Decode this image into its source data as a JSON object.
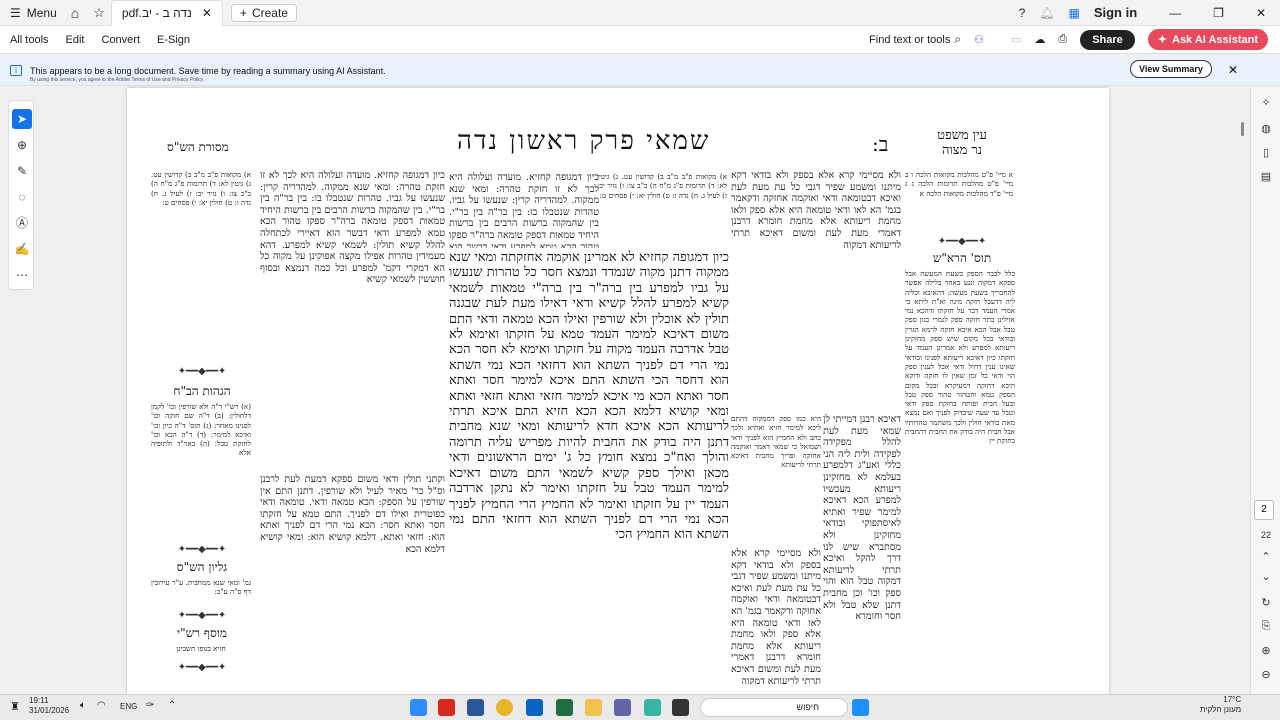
{
  "titlebar": {
    "menu_label": "Menu",
    "tab_title": "נדה ב - יב.pdf",
    "create_label": "Create",
    "signin_label": "Sign in"
  },
  "toolbar": {
    "menus": [
      "All tools",
      "Edit",
      "Convert",
      "E-Sign"
    ],
    "find_label": "Find text or tools",
    "share_label": "Share",
    "askai_label": "Ask AI Assistant"
  },
  "banner": {
    "message": "This appears to be a long document. Save time by reading a summary using AI Assistant.",
    "subtext": "By using this service, you agree to the Adobe Terms of Use and Privacy Policy.",
    "view_summary_label": "View Summary"
  },
  "page": {
    "bet": "ב:",
    "title": "שמאי פרק ראשון נדה",
    "ein_mishpat": "עין משפט\nנר מצוה",
    "masoret": "מסורת הש\"ס",
    "tosfot_label": "תוס' הרא\"ש",
    "hagahot_label": "הגהות הב\"ח",
    "gilyon_label": "גליון הש\"ס",
    "musaf_label": "מוסף רש\"י",
    "main_text": "כיון דמגופה קחזיא לא אמרינן אוקמה אחזקתה ומאי שנא ממקוה דתנן מקוה שנמדד ונמצא חסר כל טהרות שנעשו על גביו למפרע בין ברה\"ר בין ברה\"י טמאות לשמאי קשיא למפרע להלל קשיא ודאי דאילו מעת לעת שבגנה תולין לא אוכלין ולא שורפין ואילו הכא טמאה ודאי התם משום דאיכא למימר העמד טמא על חזקתו ואימא לא טבל אדרבה העמד מקוה על חזקתו ואימא לא חסר הכא נמי הרי דם לפניך השתא הוא דחזאי הכא נמי השתא הוא דחסר הכי השתא התם איכא למימר חסר ואתא חסר ואתא הכא מי איכא למימר חזאי ואתא חזאי ואתא ומאי קושיא דלמא הכא הכא חזיא התם איכא תרתי לריעותא הכא איכא חדא לריעותא ומאי שנא מחבית דתנן היה בודק את החבית להיות מפריש עליה תרומה והולך ואח\"כ נמצא חומץ כל ג' ימים הראשונים ודאי מכאן ואילך ספק קשיא לשמאי התם משום דאיכא למימר העמד טבל על חזקתו ואימר לא נתקן ארדבה העמד יין על חזקתו ואימר לא החמיץ הרי החמיץ לפניך הכא נמי הרי דם לפניך השתא הוא דחזאי התם נמי השתא הוא החמיץ הכי",
    "left_col_a": "כיון דמגופה קחזיא. מועדה ועלולה היא לכך לא זו חזקת טהרה: ומאי שנא ממקוה. למהדריה קרין: שנעשו על גביו. טהרות שנטבלו בו: בין בר\"ה בין בר\"י. בין שהמקוה ברשות הרבים בין ברשות היחיד טמאות דספק טומאה ברה\"ר ספקו טהור הכא טמא למפרע ודאי דבשר הוא דאיירי לכתחלה להלל קשיא תולין: לשמאי קשיא למפרע. דהא מעמידין טהרות אפילו מקצה אפוקינן על מקוה כל הא דמקרי דקמ' למפרע וכל כמה דנמצא ובסוף חוששין לשמאי קשיא",
    "left_col_b": "וקתני תולין ודאי משום ספקא דמעת לעת לרבנן וס\"ל כר' מאיר לעיל ולא שורפין. דתנן התם אין שורפין על הספק: הכא טמאה ודאי. טומאה ודאי כפוטרית ואילו דם לפניך. התם טמא על חזקתו חסר ואתא חסר: הכא נמי הרי דם לפניך ואתא הוא: חזאי ואתא. דלמא קושיא הוא: ומאי קושיא דלמא הכא",
    "right_col_a": "ולא מסיימי קרא אלא בספק ולא בודאי דקא מיתנו ומשמע שפיר דגבי כל עת מעת לעת ואיכא דבטומאה ודאי ואוקמה אחזקה ודקאמר בגמ' הא לאו ודאי טומאה היא אלא ספק ולאו מחמת ריעותא אלא מחמת חומרא דרבנן דאמרי מעת לעת ומשום דאיכא תרתי לריעותא דמקוה",
    "right_col_b": "דאיבא רבנן דמייתי לן שמאי מעת לעת להלל מפקידה לפקידה ולית ליה הני כללי ואע\"ג דלמפרע בעלמא לא מחזקינן ריעותא מעכשיו למפרע הכא דאיכא למימר שפיר ואתיא לאיסתפוקי ובודאי מחזקינן ולא מסתברא שיש לנו דרך להקל ואיכא תרתי לריעותא דמקוה טבל הוא והוי ספק וכו' וכן מחבית דתנן שלא טבל ולא חסר וחומרא",
    "right_col_c": "היא כמו ספק דממקוה דהתם ליכא למימר חזיא ואתיא ולכך כתב ולא החמיץ הוא לפניך ודאי ושמואל כי שמאי דאמר ואוקמה אחזקה ופריך מחבית דאיכא תרתי לריעותא",
    "far_right": "כלל לבבר הספק בשעת המעשה אבל ספקא דמקוה ונגע באהר בלילה אפשר להחבריך בשעת מעשה: דהאיבא וכליה ליה דדעבל חזקה מינה וא\"ת ליתא כי אמרי העמד דבר על חזקתו ודהכא נמי אזילינן בתר חזקה ספק לגמרי כגון ספק טבל אבל הכא איכא חזקה לרמא הגרין ובודאי בכל מקום שיש ספק מחזקינן ריעותא למפרע ולא אמרינן העמד על חזקתו כיון דאיכא ריעותא לפנינו ובודאי שאינו ענין דחיל ודאי אבל לענין ספק הוי ודאי כל זמן שאין לו חזקה ודוקא היכא דחזקה דמעיקרא ובכל מקום הספק טמא והטהור טהור",
    "far_right_b": "ספק טבל ובעל הבית ופותח בחזקת ספק ודאי וטבל עד שעה שיבדוק לפניך ואם נמצא מאת בודאי חולין ולכך משתמר טהרותיו אבל חבית היה בודק את החבית דהחבית בחזקת יין",
    "small_notes": "א) מקואות פ\"ב מ\"ב ב) קדושין עט. ג) גיטין לא: ד) תרומות פ\"ג מ\"ח ה) ב\"ב צו: ו) נזיר יב: ז) לעיל ג. ח) נדה ו: ט) חולין יא: י) פסחים ט:",
    "hagahot_text": "(א) רש\"י ד\"ה ולא שורפין וכו' לקמן דלחולין: (ב) ד\"ה שם חזקה וכו' לפנינו מאחר: (ג) תוס' ד\"ה כיון וכו' ואיכא למימר: (ד) ד\"ה הכא וכו' לחזקת טבל: (ה) באר\"ד ולתופיה אלא",
    "gilyon_text": "גמ' ומאי שנא ממחבית. ע\"ר עירובין דף ס\"ה ע\"ב:",
    "musaf_text": "חזיא בגופו חשבינן",
    "ein_notes": "א מיי' פ\"ט מהלכות מקואות הלכה ו ב מיי' פ\"ט מהלכות תרומות הלכה ג ג מיי' פ\"ד מהלכות מקואות הלכה א"
  },
  "rightrail": {
    "page_num": "2",
    "page_total": "22"
  },
  "taskbar": {
    "time": "19:11",
    "date": "31/01/2026",
    "lang": "ENG",
    "search_placeholder": "חיפוש",
    "temp": "17°C",
    "weather": "מעונן חלקית"
  },
  "colors": {
    "accent": "#1473e6",
    "askai": "#e8495c"
  }
}
